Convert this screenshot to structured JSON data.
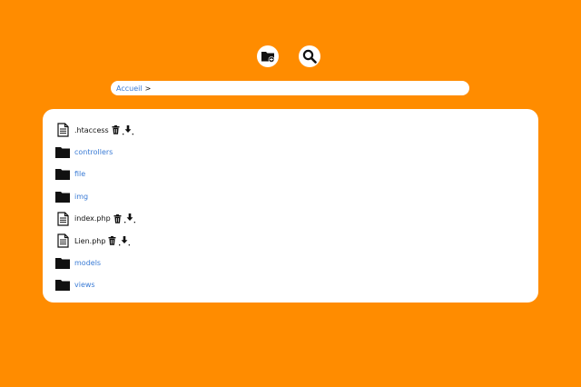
{
  "toolbar": {
    "new_folder_icon": "folder-plus-icon",
    "search_icon": "search-icon"
  },
  "breadcrumb": {
    "root_label": "Accueil",
    "separator": ">"
  },
  "files": [
    {
      "name": ".htaccess",
      "type": "file",
      "actions": [
        "trash-icon",
        "download-icon"
      ]
    },
    {
      "name": "controllers",
      "type": "folder"
    },
    {
      "name": "file",
      "type": "folder"
    },
    {
      "name": "img",
      "type": "folder"
    },
    {
      "name": "index.php",
      "type": "file",
      "actions": [
        "trash-icon",
        "download-icon"
      ]
    },
    {
      "name": "Lien.php",
      "type": "file",
      "actions": [
        "trash-icon",
        "download-icon"
      ]
    },
    {
      "name": "models",
      "type": "folder"
    },
    {
      "name": "views",
      "type": "folder"
    }
  ],
  "colors": {
    "background": "#ff8c00",
    "link": "#3a7bd5",
    "panel": "#ffffff"
  }
}
